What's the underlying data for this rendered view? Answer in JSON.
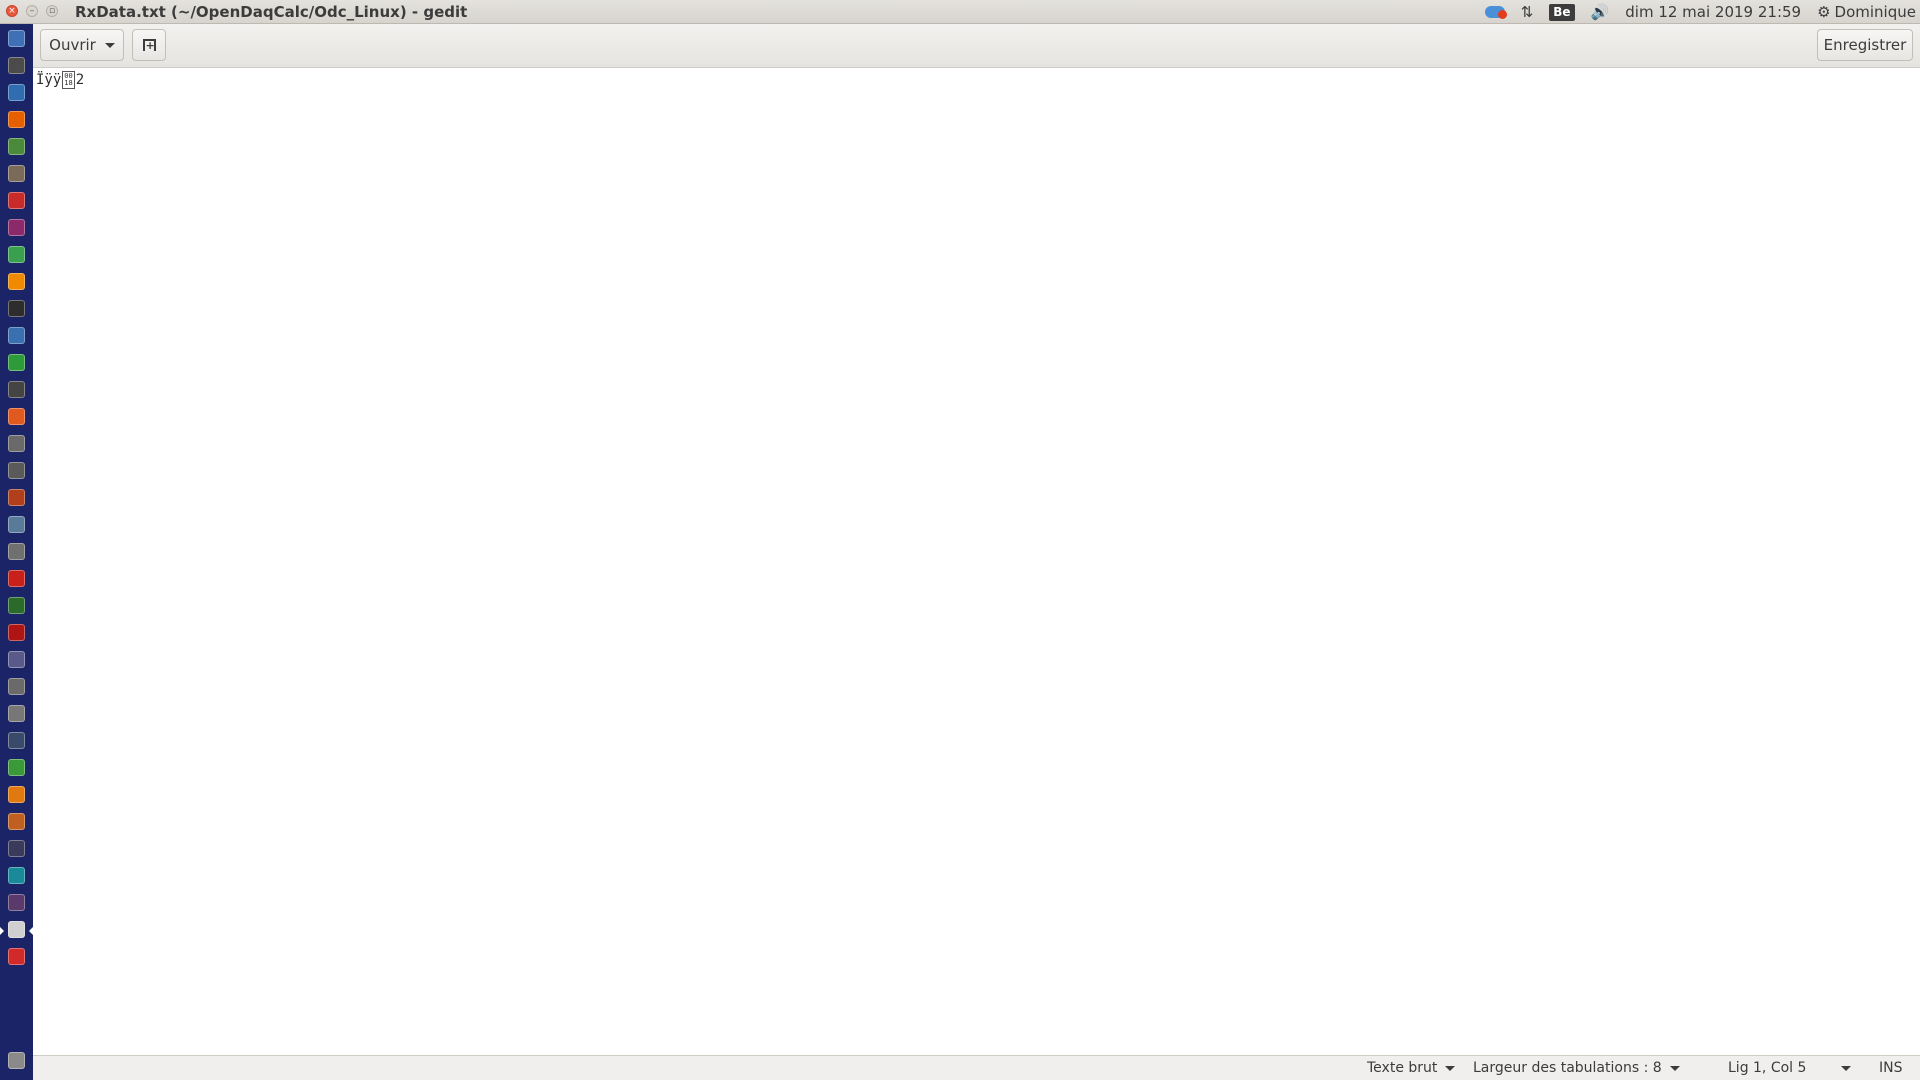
{
  "window": {
    "title": "RxData.txt (~/OpenDaqCalc/Odc_Linux) - gedit",
    "close_glyph": "×",
    "minimize_glyph": "–",
    "maximize_glyph": "▫"
  },
  "tray": {
    "keyboard_label": "Be",
    "network_glyph": "⇅",
    "volume_glyph": "🔊",
    "clock": "dim 12 mai 2019 21:59",
    "settings_glyph": "⚙",
    "user": "Dominique",
    "icons": [
      "cloud-sync-icon",
      "network-icon",
      "keyboard-layout-icon",
      "volume-icon",
      "settings-gear-icon"
    ]
  },
  "toolbar": {
    "open_label": "Ouvrir",
    "save_label": "Enregistrer",
    "new_tab_glyph": "+"
  },
  "editor": {
    "text_prefix": "Ïÿÿ",
    "control_char_glyph": "00\n18",
    "text_suffix": "2"
  },
  "statusbar": {
    "language": "Texte brut",
    "tab_width": "Largeur des tabulations : 8",
    "position": "Lig 1, Col 5",
    "insert_mode": "INS"
  },
  "launcher": {
    "items": [
      {
        "name": "dash-icon",
        "color": "#3f6fb5"
      },
      {
        "name": "workspace-icon",
        "color": "#4b4b4b"
      },
      {
        "name": "virtualbox-icon",
        "color": "#2f6db0"
      },
      {
        "name": "firefox-icon",
        "color": "#e66000"
      },
      {
        "name": "chrome-icon",
        "color": "#4a8a3a"
      },
      {
        "name": "files-icon",
        "color": "#7a6a5a"
      },
      {
        "name": "pdf-icon",
        "color": "#c92b2b"
      },
      {
        "name": "media-icon",
        "color": "#8a2a6a"
      },
      {
        "name": "storage-icon",
        "color": "#3aa050"
      },
      {
        "name": "vlc-icon",
        "color": "#f08a00"
      },
      {
        "name": "terminal-icon",
        "color": "#2d2d2d"
      },
      {
        "name": "writer-icon",
        "color": "#3a6fb0"
      },
      {
        "name": "calc-icon",
        "color": "#2e9b3a"
      },
      {
        "name": "screen-icon",
        "color": "#444444"
      },
      {
        "name": "software-center-icon",
        "color": "#e05a20"
      },
      {
        "name": "system-settings-icon",
        "color": "#6a6a6a"
      },
      {
        "name": "archive-icon",
        "color": "#5a5a5a"
      },
      {
        "name": "editor-icon",
        "color": "#b0401c"
      },
      {
        "name": "image-viewer-icon",
        "color": "#5a7a9a"
      },
      {
        "name": "camera-icon",
        "color": "#707070"
      },
      {
        "name": "flash-icon",
        "color": "#c8201a"
      },
      {
        "name": "p-app-icon",
        "color": "#2a6a2a"
      },
      {
        "name": "filezilla-icon",
        "color": "#b01515"
      },
      {
        "name": "network-tool-icon",
        "color": "#5a5a8a"
      },
      {
        "name": "cloud-app-icon",
        "color": "#6a6a6a"
      },
      {
        "name": "disc-icon",
        "color": "#777777"
      },
      {
        "name": "compass-icon",
        "color": "#3a4a6a"
      },
      {
        "name": "tools-icon",
        "color": "#3a9a3a"
      },
      {
        "name": "e-app-icon",
        "color": "#e07a10"
      },
      {
        "name": "document-viewer-icon",
        "color": "#c06020"
      },
      {
        "name": "usb-icon",
        "color": "#3a3a5a"
      },
      {
        "name": "arduino-icon",
        "color": "#1a8a9a"
      },
      {
        "name": "monitor-icon",
        "color": "#5a3a6a"
      },
      {
        "name": "gedit-icon",
        "color": "#d0d0d0"
      },
      {
        "name": "color-app-icon",
        "color": "#d02a2a"
      }
    ],
    "trash": {
      "name": "trash-icon",
      "color": "#8a8a8a"
    }
  }
}
